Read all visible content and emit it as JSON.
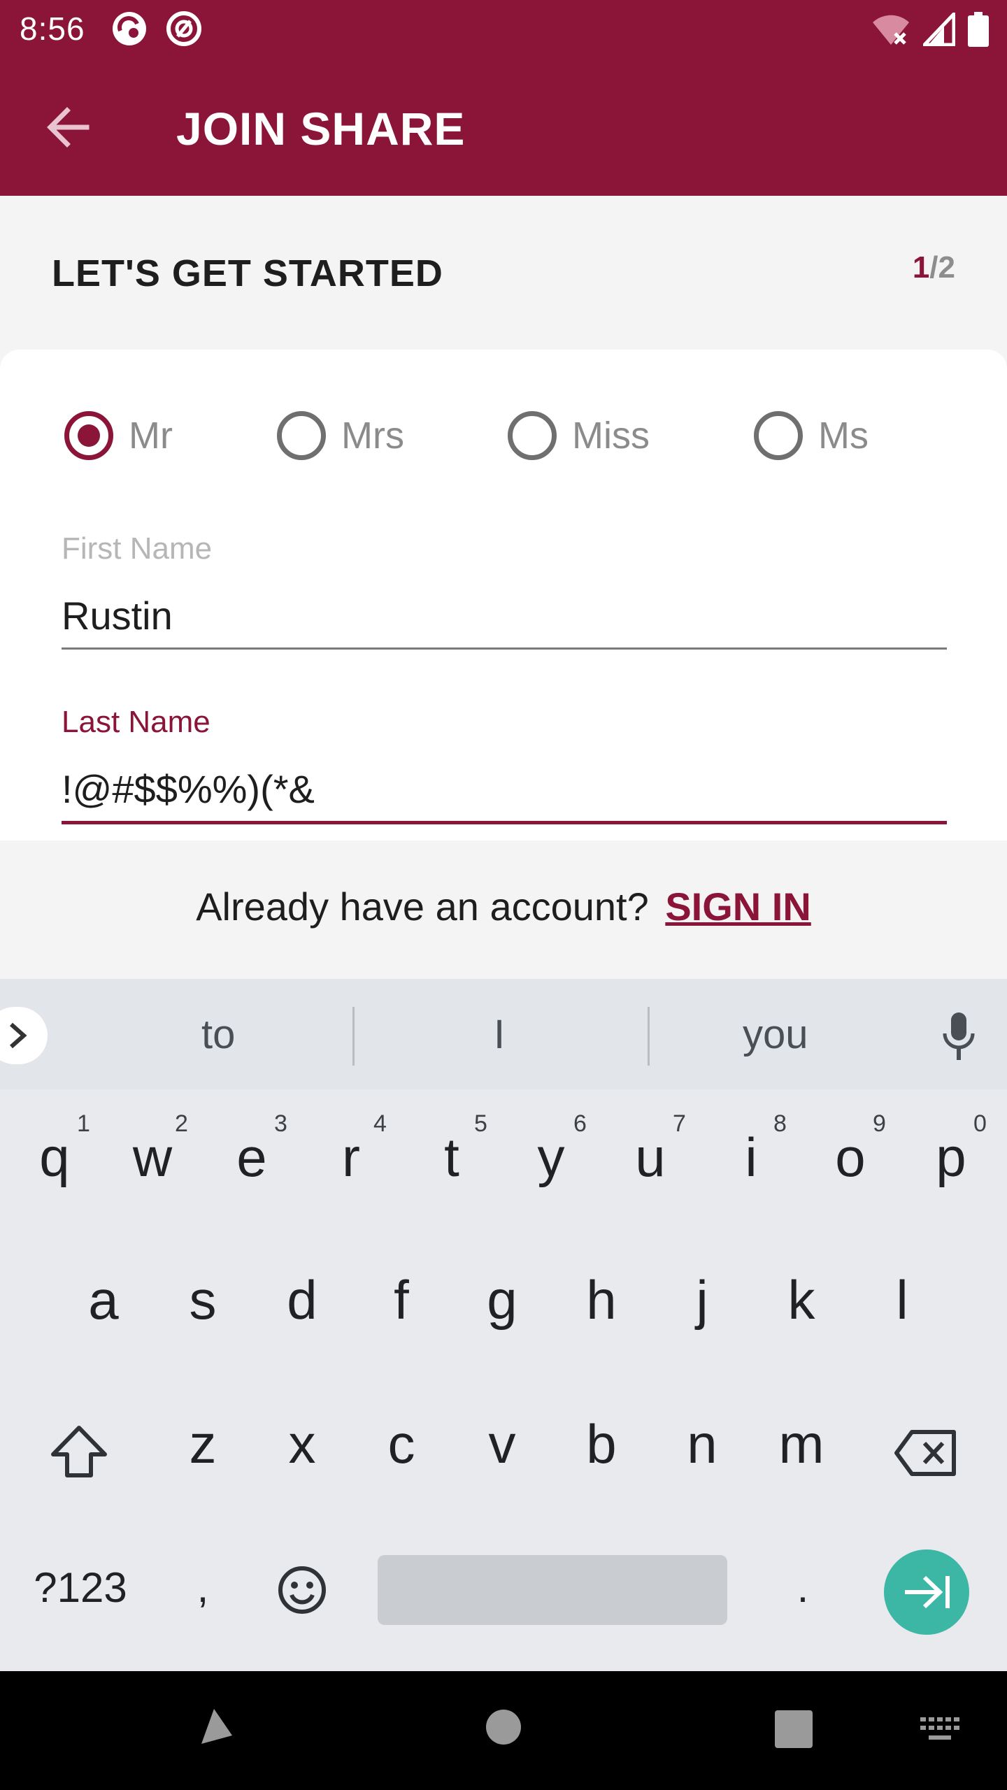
{
  "status_bar": {
    "time": "8:56",
    "icons": [
      "notification-icon-1",
      "notification-icon-2",
      "wifi-off-icon",
      "signal-icon",
      "battery-icon"
    ]
  },
  "app_bar": {
    "title": "JOIN SHARE",
    "back_icon": "arrow-back-icon"
  },
  "header": {
    "heading": "LET'S GET STARTED",
    "step_current": "1",
    "step_total": "/2"
  },
  "form": {
    "titles": [
      {
        "label": "Mr",
        "selected": true
      },
      {
        "label": "Mrs",
        "selected": false
      },
      {
        "label": "Miss",
        "selected": false
      },
      {
        "label": "Ms",
        "selected": false
      }
    ],
    "first_name": {
      "label": "First Name",
      "value": "Rustin"
    },
    "last_name": {
      "label": "Last Name",
      "value": "!@#$$%%)(*&"
    }
  },
  "signin": {
    "prompt": "Already have an account?",
    "link": "SIGN IN"
  },
  "keyboard": {
    "suggestions": [
      "to",
      "I",
      "you"
    ],
    "row1": [
      "q",
      "w",
      "e",
      "r",
      "t",
      "y",
      "u",
      "i",
      "o",
      "p"
    ],
    "row1_hints": [
      "1",
      "2",
      "3",
      "4",
      "5",
      "6",
      "7",
      "8",
      "9",
      "0"
    ],
    "row2": [
      "a",
      "s",
      "d",
      "f",
      "g",
      "h",
      "j",
      "k",
      "l"
    ],
    "row3": [
      "z",
      "x",
      "c",
      "v",
      "b",
      "n",
      "m"
    ],
    "symbols_key": "?123",
    "comma": ",",
    "period": "."
  },
  "colors": {
    "brand": "#8b1538",
    "enter_key": "#3cb7a6"
  }
}
